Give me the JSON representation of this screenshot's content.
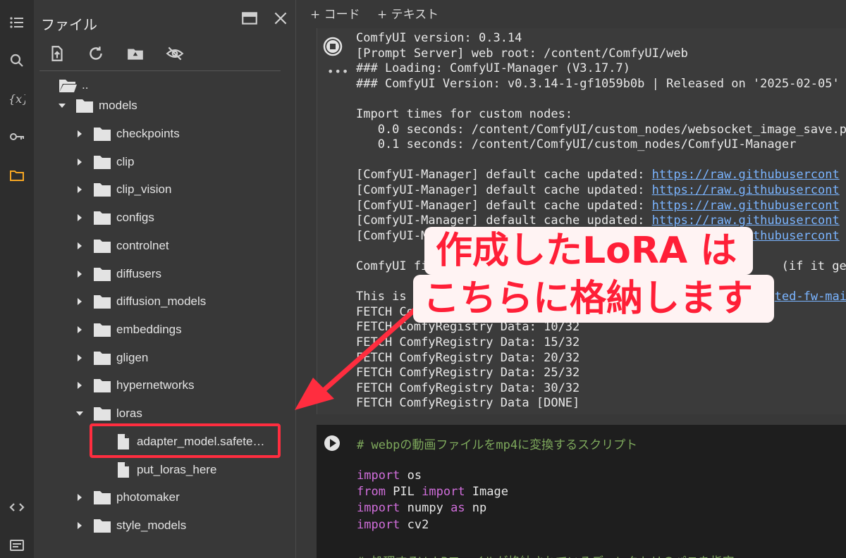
{
  "panel": {
    "title": "ファイル"
  },
  "tree": {
    "parent": "..",
    "models": "models",
    "children": [
      "checkpoints",
      "clip",
      "clip_vision",
      "configs",
      "controlnet",
      "diffusers",
      "diffusion_models",
      "embeddings",
      "gligen",
      "hypernetworks"
    ],
    "loras": "loras",
    "lora_files": [
      "adapter_model.safete…",
      "put_loras_here"
    ],
    "after": [
      "photomaker",
      "style_models"
    ]
  },
  "toolbar": {
    "add_code": "+ コード",
    "add_text": "+ テキスト"
  },
  "output": {
    "lines": [
      "ComfyUI version: 0.3.14",
      "[Prompt Server] web root: /content/ComfyUI/web",
      "### Loading: ComfyUI-Manager (V3.17.7)",
      "### ComfyUI Version: v0.3.14-1-gf1059b0b | Released on '2025-02-05'",
      "",
      "Import times for custom nodes:",
      "   0.0 seconds: /content/ComfyUI/custom_nodes/websocket_image_save.py",
      "   0.1 seconds: /content/ComfyUI/custom_nodes/ComfyUI-Manager"
    ],
    "cache_prefix": "[ComfyUI-Manager] default cache updated: ",
    "cache_link": "https://raw.githubusercont",
    "comfyui_prefix": "ComfyUI fi",
    "comfyui_suffix": " (if it gets",
    "this_is": "This is",
    "this_is_link": "ted-fw-mai",
    "fetch_first": "FETCH Co",
    "fetch_lines": [
      "FETCH ComfyRegistry Data: 10/32",
      "FETCH ComfyRegistry Data: 15/32",
      "FETCH ComfyRegistry Data: 20/32",
      "FETCH ComfyRegistry Data: 25/32",
      "FETCH ComfyRegistry Data: 30/32",
      "FETCH ComfyRegistry Data [DONE]"
    ]
  },
  "code": {
    "comment": "# webpの動画ファイルをmp4に変換するスクリプト",
    "import_kw": "import",
    "from_kw": "from",
    "as_kw": "as",
    "os": " os",
    "pil": " PIL ",
    "image": " Image",
    "numpy": " numpy ",
    "np": " np",
    "cv2": " cv2",
    "comment2": "# 処理するWebPファイルが格納されているディレクトリのパスを指定"
  },
  "callout": {
    "line1": "作成したLoRA は",
    "line2": "こちらに格納します"
  },
  "colors": {
    "callout_text": "#ff1f37",
    "highlight": "#ff2d3f",
    "link": "#7ab4ff",
    "keyword": "#d16edc",
    "comment": "#7ea95c"
  }
}
